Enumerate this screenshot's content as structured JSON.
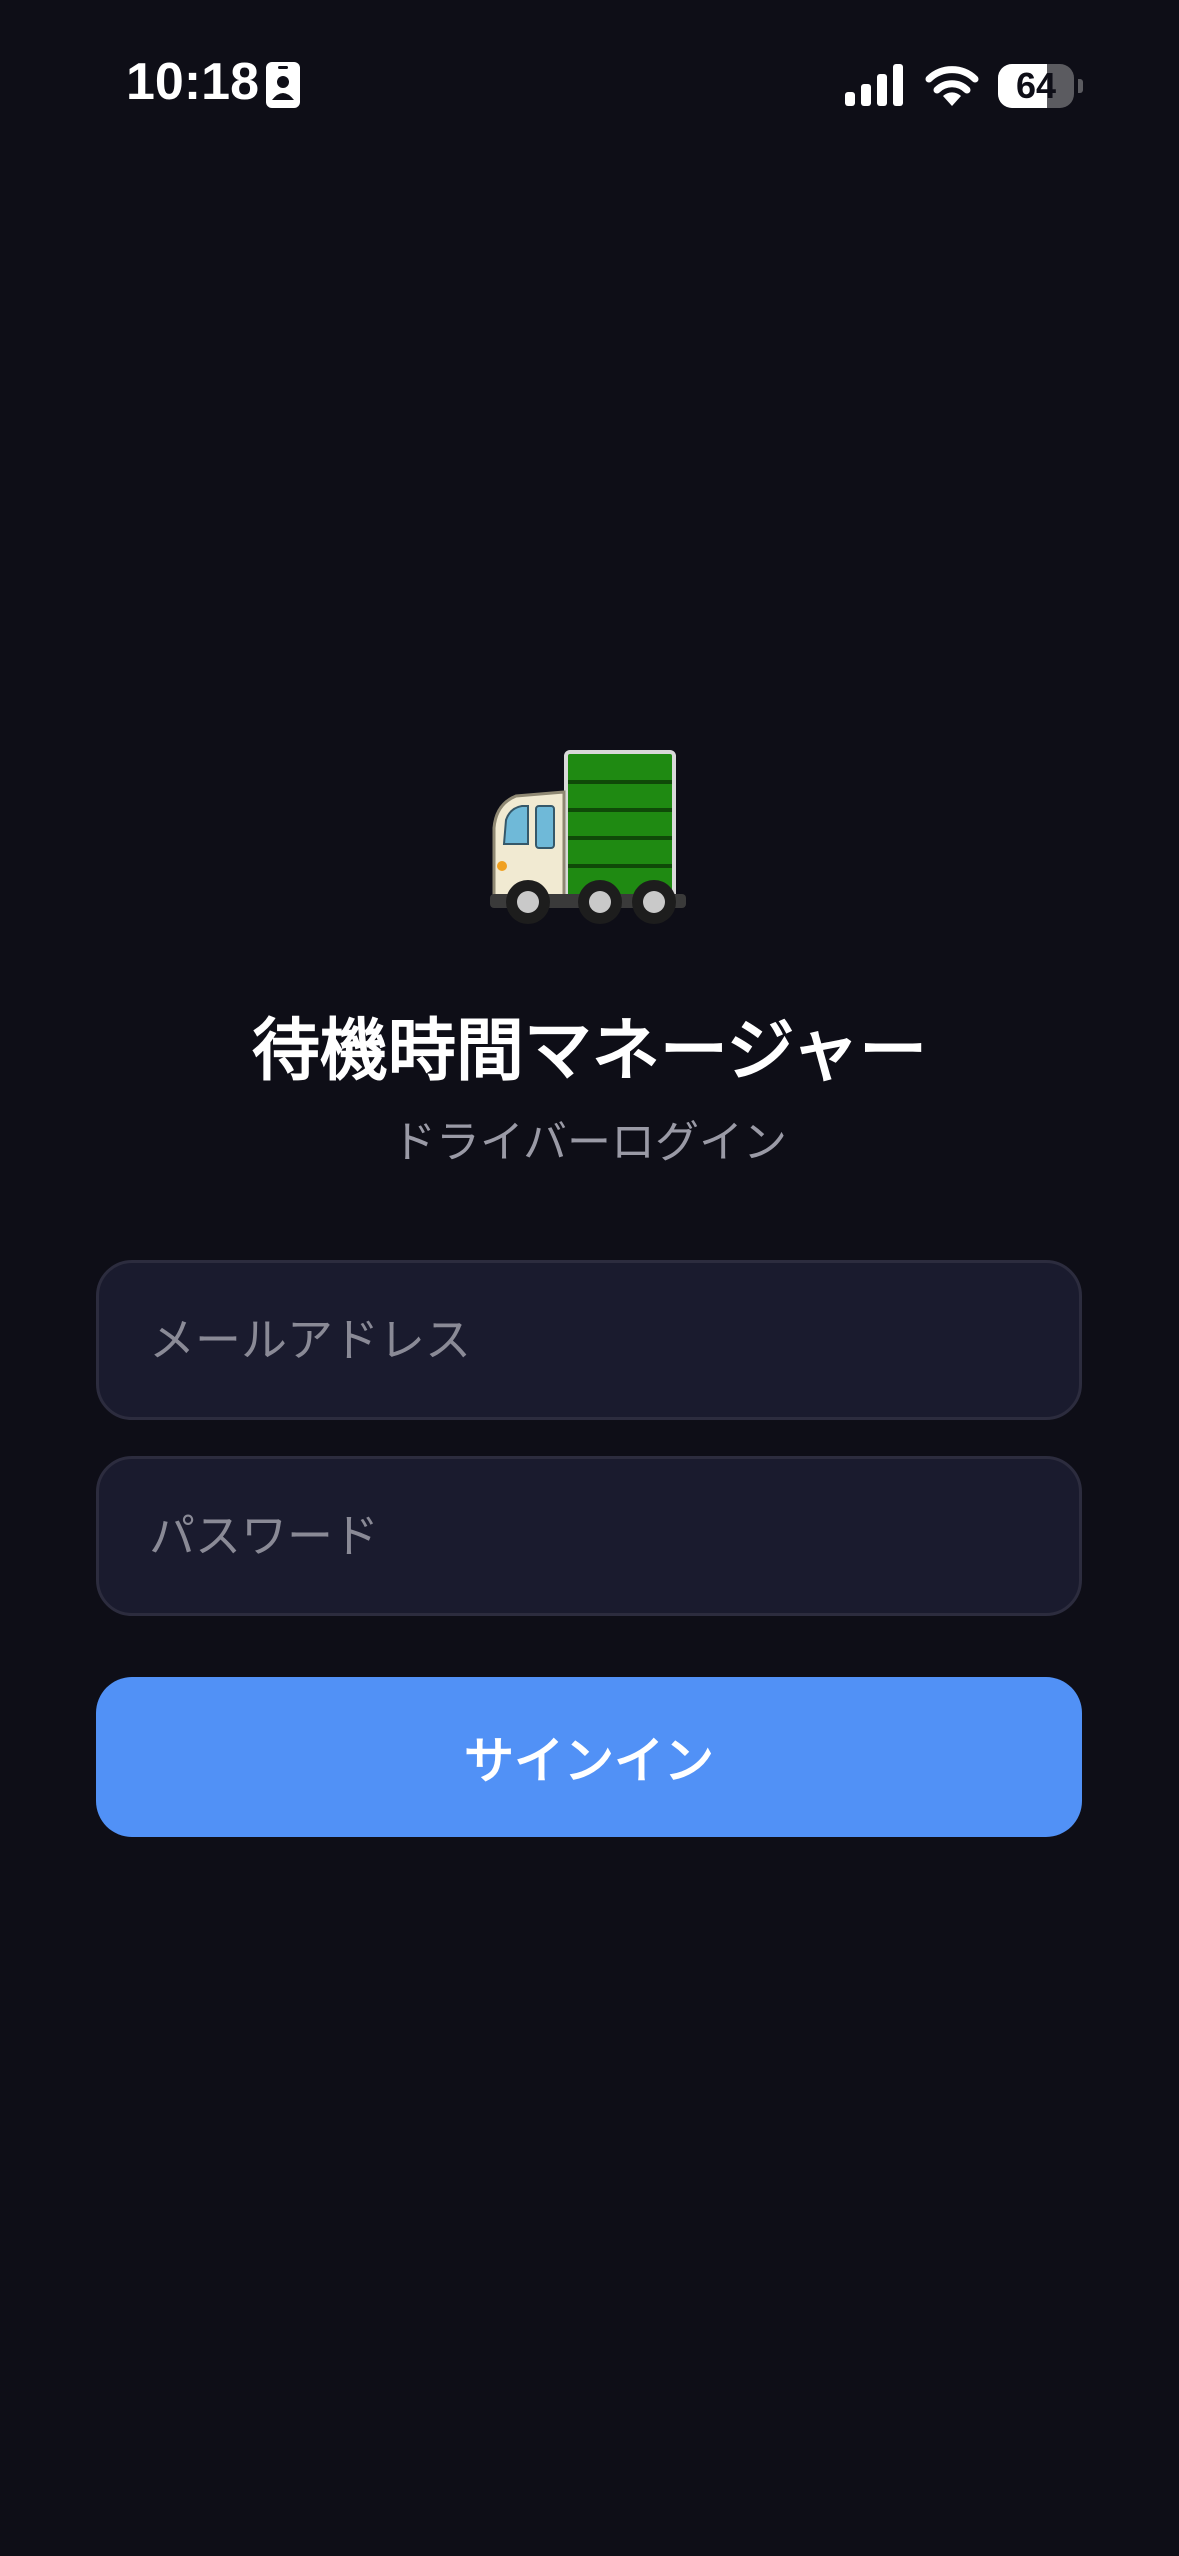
{
  "status_bar": {
    "time": "10:18",
    "battery_level": "64",
    "battery_fraction": 0.64,
    "icons": [
      "id-badge-icon",
      "signal-icon",
      "wifi-icon",
      "battery-icon"
    ]
  },
  "app": {
    "icon": "truck-icon",
    "title": "待機時間マネージャー",
    "subtitle": "ドライバーログイン"
  },
  "form": {
    "email_placeholder": "メールアドレス",
    "password_placeholder": "パスワード",
    "signin_label": "サインイン"
  },
  "colors": {
    "background": "#0e0e17",
    "field_background": "#1a1b2e",
    "field_border": "#2c2c3e",
    "accent": "#5191f6",
    "truck_cargo": "#1f8a12"
  }
}
